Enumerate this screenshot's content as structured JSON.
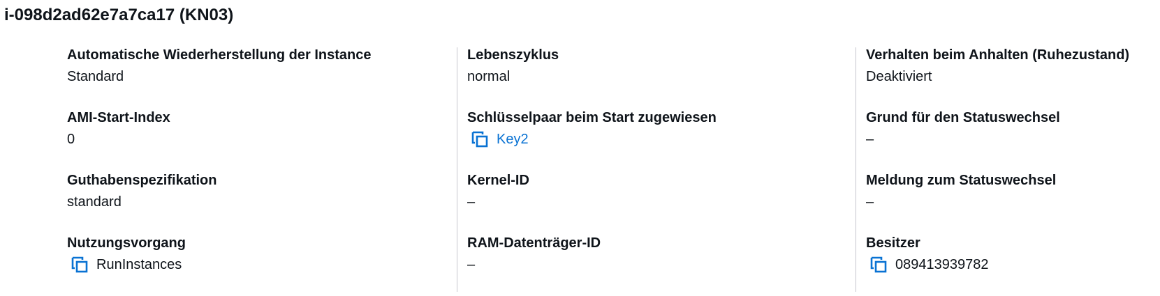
{
  "header": {
    "title": "i-098d2ad62e7a7ca17 (KN03)"
  },
  "colors": {
    "link": "#0972d3",
    "text": "#0f141a",
    "divider": "#c6c6cd"
  },
  "columns": [
    {
      "fields": [
        {
          "label": "Automatische Wiederherstellung der Instance",
          "value": "Standard"
        },
        {
          "label": "AMI-Start-Index",
          "value": "0"
        },
        {
          "label": "Guthabenspezifikation",
          "value": "standard"
        },
        {
          "label": "Nutzungsvorgang",
          "value": "RunInstances",
          "icon": "copy-icon"
        }
      ]
    },
    {
      "fields": [
        {
          "label": "Lebenszyklus",
          "value": "normal"
        },
        {
          "label": "Schlüsselpaar beim Start zugewiesen",
          "value": "Key2",
          "icon": "copy-icon",
          "link": true
        },
        {
          "label": "Kernel-ID",
          "value": "–"
        },
        {
          "label": "RAM-Datenträger-ID",
          "value": "–"
        }
      ]
    },
    {
      "fields": [
        {
          "label": "Verhalten beim Anhalten (Ruhezustand)",
          "value": "Deaktiviert"
        },
        {
          "label": "Grund für den Statuswechsel",
          "value": "–"
        },
        {
          "label": "Meldung zum Statuswechsel",
          "value": "–"
        },
        {
          "label": "Besitzer",
          "value": "089413939782",
          "icon": "copy-icon"
        }
      ]
    }
  ]
}
